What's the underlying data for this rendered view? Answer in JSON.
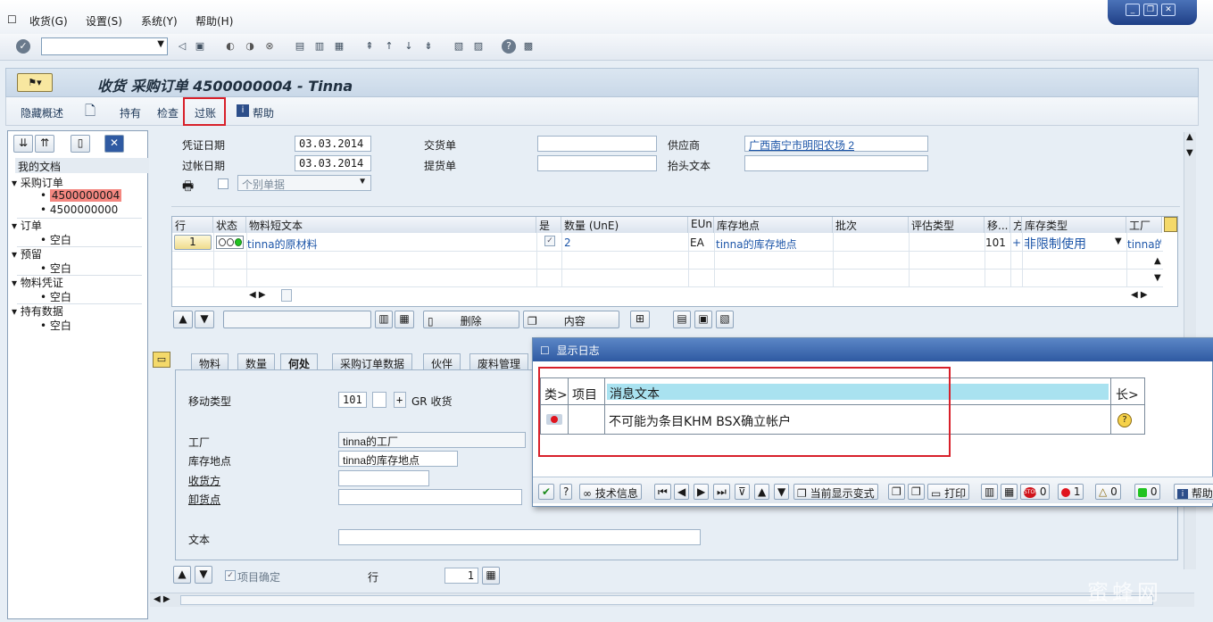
{
  "menubar": {
    "items": [
      "收货(G)",
      "设置(S)",
      "系统(Y)",
      "帮助(H)"
    ]
  },
  "title": "收货 采购订单 4500000004 - Tinna",
  "app_toolbar": {
    "hide_overview": "隐藏概述",
    "hold": "持有",
    "check": "检查",
    "post": "过账",
    "help": "帮助"
  },
  "tree": {
    "my_docs": "我的文档",
    "nodes": [
      {
        "label": "采购订单",
        "children": [
          "4500000004",
          "4500000000"
        ]
      },
      {
        "label": "订单",
        "children": [
          "空白"
        ]
      },
      {
        "label": "预留",
        "children": [
          "空白"
        ]
      },
      {
        "label": "物料凭证",
        "children": [
          "空白"
        ]
      },
      {
        "label": "持有数据",
        "children": [
          "空白"
        ]
      }
    ]
  },
  "header": {
    "doc_date_label": "凭证日期",
    "doc_date": "03.03.2014",
    "post_date_label": "过帐日期",
    "post_date": "03.03.2014",
    "delivery_note_label": "交货单",
    "delivery_note": "",
    "bill_of_lading_label": "提货单",
    "bill_of_lading": "",
    "vendor_label": "供应商",
    "vendor": "广西南宁市明阳农场 2",
    "header_text_label": "抬头文本",
    "header_text": "",
    "slip_select": "个别单据"
  },
  "grid": {
    "columns": [
      "行",
      "状态",
      "物料短文本",
      "是",
      "数量 (UnE)",
      "EUn",
      "库存地点",
      "批次",
      "评估类型",
      "移...",
      "方",
      "库存类型",
      "工厂"
    ],
    "rows": [
      {
        "line": "1",
        "material": "tinna的原材料",
        "qty": "2",
        "eun": "EA",
        "sloc": "tinna的库存地点",
        "mvt": "101",
        "dir": "+",
        "stock_type": "非限制使用",
        "plant": "tinna的"
      }
    ]
  },
  "grid_toolbar": {
    "delete": "删除",
    "content": "内容"
  },
  "tabs": [
    "物料",
    "数量",
    "何处",
    "采购订单数据",
    "伙伴",
    "废料管理"
  ],
  "where_tab": {
    "mvt_type_label": "移动类型",
    "mvt_type": "101",
    "sign": "+",
    "mvt_text": "GR 收货",
    "plant_label": "工厂",
    "plant": "tinna的工厂",
    "sloc_label": "库存地点",
    "sloc": "tinna的库存地点",
    "recipient_label": "收货方",
    "recipient": "",
    "unload_label": "卸货点",
    "unload": "",
    "text_label": "文本",
    "text": ""
  },
  "footer": {
    "item_ok": "项目确定",
    "line_label": "行",
    "line_value": "1"
  },
  "dialog": {
    "title": "显示日志",
    "col_type": "类>",
    "col_item": "项目",
    "col_msg": "消息文本",
    "col_long": "长>",
    "message": "不可能为条目KHM BSX确立帐户",
    "tb_tech": "技术信息",
    "tb_display_variant": "当前显示变式",
    "tb_print": "打印",
    "tb_help": "帮助",
    "counts": {
      "stop": "0",
      "error": "1",
      "warning": "0",
      "success": "0"
    }
  },
  "watermark": "蜜蜂网"
}
